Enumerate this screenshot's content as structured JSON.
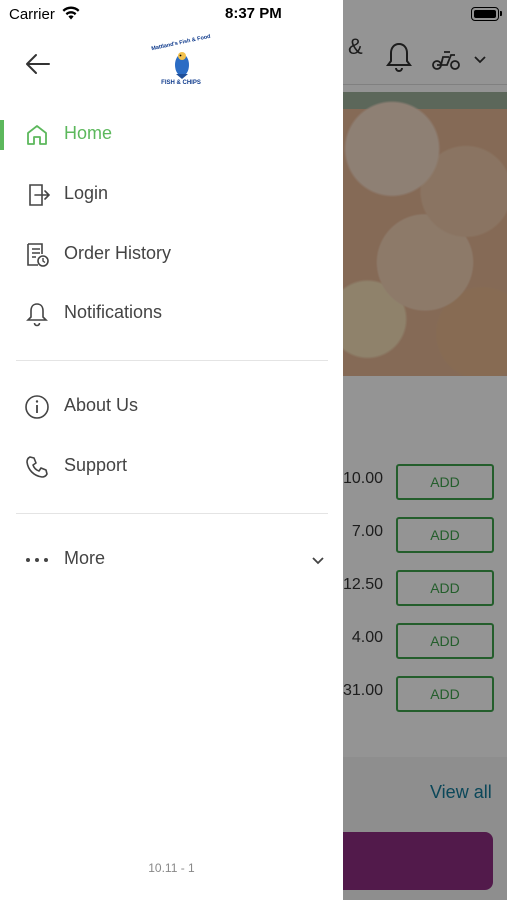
{
  "status_bar": {
    "carrier": "Carrier",
    "time": "8:37 PM",
    "wifi_icon": "wifi-icon",
    "battery_icon": "battery-icon"
  },
  "logo": {
    "brand_name": "Mattland's Fish & Food",
    "bottom_text": "FISH & CHIPS"
  },
  "drawer": {
    "back_icon": "arrow-left-icon",
    "menu": [
      {
        "label": "Home",
        "icon": "home-icon",
        "active": true
      },
      {
        "label": "Login",
        "icon": "login-icon"
      },
      {
        "label": "Order History",
        "icon": "order-history-icon"
      },
      {
        "label": "Notifications",
        "icon": "bell-icon"
      },
      {
        "label": "About Us",
        "icon": "info-icon"
      },
      {
        "label": "Support",
        "icon": "phone-icon"
      },
      {
        "label": "More",
        "icon": "more-dots-icon"
      }
    ],
    "version": "10.11 - 1"
  },
  "background": {
    "title_fragment": "&",
    "menu_rows": [
      {
        "price": "10.00",
        "button": "ADD"
      },
      {
        "price": "7.00",
        "button": "ADD"
      },
      {
        "price": "12.50",
        "button": "ADD"
      },
      {
        "price": "4.00",
        "button": "ADD"
      },
      {
        "price": "31.00",
        "button": "ADD"
      }
    ],
    "view_all": "View all"
  },
  "colors": {
    "accent_green": "#5cb85c",
    "add_green": "#3fa34d",
    "link_blue": "#137a9a",
    "cta_purple": "#8e2d82"
  }
}
